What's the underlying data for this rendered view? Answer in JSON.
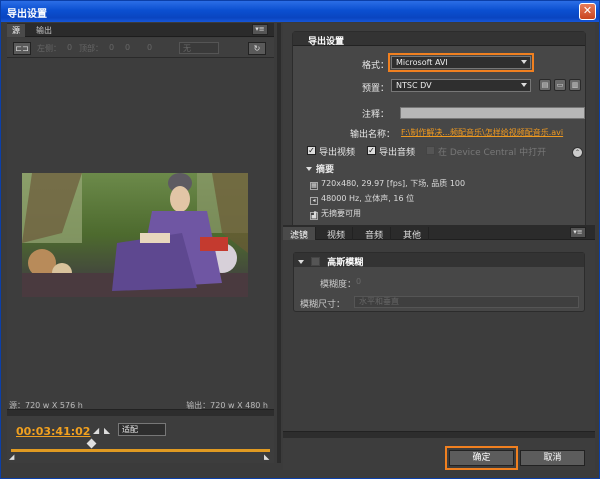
{
  "window": {
    "title": "导出设置",
    "close_glyph": "✕"
  },
  "left_panel": {
    "tabs": [
      {
        "label": "源"
      },
      {
        "label": "输出"
      }
    ],
    "toolbar": {
      "crop_glyph": "⊏⊐",
      "left_label": "左侧：",
      "left_value": "0",
      "top_label": "顶部：",
      "top_value": "0",
      "other_values": [
        "0",
        "0"
      ],
      "aspect_select": "无",
      "rotate_glyph": "↻"
    },
    "source_info": "源：720 w X 576 h",
    "output_info": "输出：720 w X 480 h",
    "timecode": "00:03:41:02",
    "zoom_select": "适配"
  },
  "export_settings": {
    "header": "导出设置",
    "format_label": "格式：",
    "format_value": "Microsoft AVI",
    "preset_label": "预置：",
    "preset_value": "NTSC DV",
    "comment_label": "注释：",
    "comment_value": "",
    "output_name_label": "输出名称：",
    "output_name_value": "F:\\制作解决...频配音乐\\怎样给视频配音乐.avi",
    "export_video_label": "导出视频",
    "export_video_checked": true,
    "export_audio_label": "导出音频",
    "export_audio_checked": true,
    "device_central_label": "在 Device Central 中打开",
    "device_central_checked": false,
    "summary_header": "摘要",
    "summary_lines": [
      "720x480, 29.97 [fps], 下场, 品质 100",
      "48000 Hz, 立体声, 16 位",
      "无摘要可用"
    ]
  },
  "right_tabs": [
    {
      "label": "滤镜"
    },
    {
      "label": "视频"
    },
    {
      "label": "音频"
    },
    {
      "label": "其他"
    }
  ],
  "filter": {
    "header": "高斯模糊",
    "blurriness_label": "模糊度：",
    "blurriness_value": "0",
    "blur_dim_label": "模糊尺寸：",
    "blur_dim_value": "水平和垂直"
  },
  "buttons": {
    "ok": "确定",
    "cancel": "取消"
  },
  "colors": {
    "accent": "#f08020",
    "title_bar": "#0b4fd0",
    "timecode": "#f0a020",
    "panel_bg": "#3d3d3d"
  }
}
